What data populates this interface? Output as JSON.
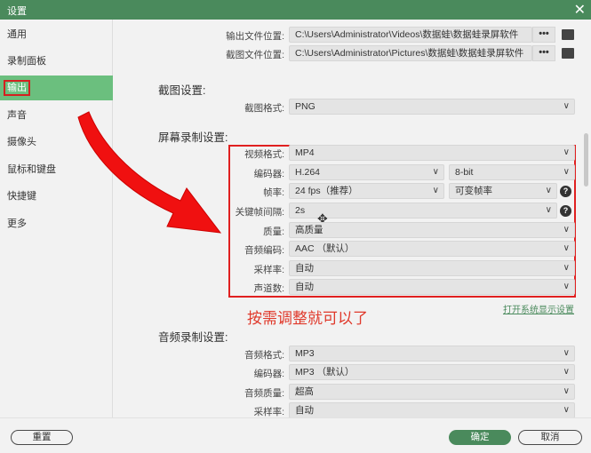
{
  "title": "设置",
  "sidebar": {
    "items": [
      {
        "label": "通用"
      },
      {
        "label": "录制面板"
      },
      {
        "label": "输出",
        "active": true
      },
      {
        "label": "声音"
      },
      {
        "label": "摄像头"
      },
      {
        "label": "鼠标和键盘"
      },
      {
        "label": "快捷键"
      },
      {
        "label": "更多"
      }
    ]
  },
  "paths": {
    "output_label": "输出文件位置:",
    "output_value": "C:\\Users\\Administrator\\Videos\\数据蛙\\数据蛙录屏软件",
    "shot_label": "截图文件位置:",
    "shot_value": "C:\\Users\\Administrator\\Pictures\\数据蛙\\数据蛙录屏软件",
    "dots": "•••"
  },
  "screenshot": {
    "heading": "截图设置:",
    "format_label": "截图格式:",
    "format_value": "PNG"
  },
  "screen": {
    "heading": "屏幕录制设置:",
    "video_format_label": "视频格式:",
    "video_format": "MP4",
    "encoder_label": "编码器:",
    "encoder": "H.264",
    "bitdepth": "8-bit",
    "fps_label": "帧率:",
    "fps": "24 fps（推荐）",
    "fps_mode": "可变帧率",
    "keyframe_label": "关键帧间隔:",
    "keyframe": "2s",
    "quality_label": "质量:",
    "quality": "高质量",
    "audio_codec_label": "音频编码:",
    "audio_codec": "AAC （默认）",
    "samplerate_label": "采样率:",
    "samplerate": "自动",
    "channels_label": "声道数:",
    "channels": "自动"
  },
  "annotation": "按需调整就可以了",
  "display_link": "打开系统显示设置",
  "audio": {
    "heading": "音频录制设置:",
    "format_label": "音频格式:",
    "format": "MP3",
    "encoder_label": "编码器:",
    "encoder": "MP3 （默认）",
    "quality_label": "音频质量:",
    "quality": "超高",
    "samplerate_label": "采样率:",
    "samplerate": "自动"
  },
  "buttons": {
    "reset": "重置",
    "ok": "确定",
    "cancel": "取消"
  },
  "colors": {
    "titlebar": "#4a8a5c",
    "active": "#6bbf7e",
    "highlight": "#e02020"
  }
}
